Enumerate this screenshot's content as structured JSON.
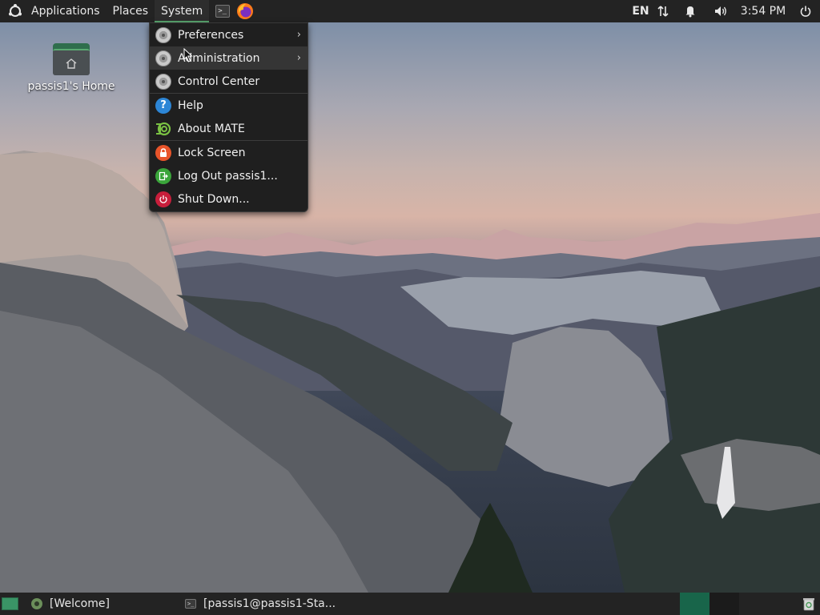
{
  "top_panel": {
    "applications_label": "Applications",
    "places_label": "Places",
    "system_label": "System",
    "tray": {
      "language": "EN",
      "clock": "3:54 PM"
    }
  },
  "desktop": {
    "home_icon_label": "passis1's Home"
  },
  "system_menu": {
    "items": [
      {
        "label": "Preferences",
        "icon": "gear-icon",
        "has_submenu": true
      },
      {
        "label": "Administration",
        "icon": "gear-icon",
        "has_submenu": true
      },
      {
        "label": "Control Center",
        "icon": "gear-icon",
        "has_submenu": false
      },
      {
        "label": "Help",
        "icon": "help-icon",
        "has_submenu": false
      },
      {
        "label": "About MATE",
        "icon": "mate-icon",
        "has_submenu": false
      },
      {
        "label": "Lock Screen",
        "icon": "lock-icon",
        "has_submenu": false
      },
      {
        "label": "Log Out passis1...",
        "icon": "logout-icon",
        "has_submenu": false
      },
      {
        "label": "Shut Down...",
        "icon": "power-icon",
        "has_submenu": false
      }
    ],
    "submenu_arrow": "›"
  },
  "bottom_panel": {
    "tasks": [
      {
        "label": "[Welcome]"
      },
      {
        "label": "[passis1@passis1-Sta..."
      }
    ]
  },
  "colors": {
    "panel_bg": "#232323",
    "accent_green": "#5aa971",
    "menu_bg": "#1f1f1f",
    "workspace_active": "#18654a"
  }
}
